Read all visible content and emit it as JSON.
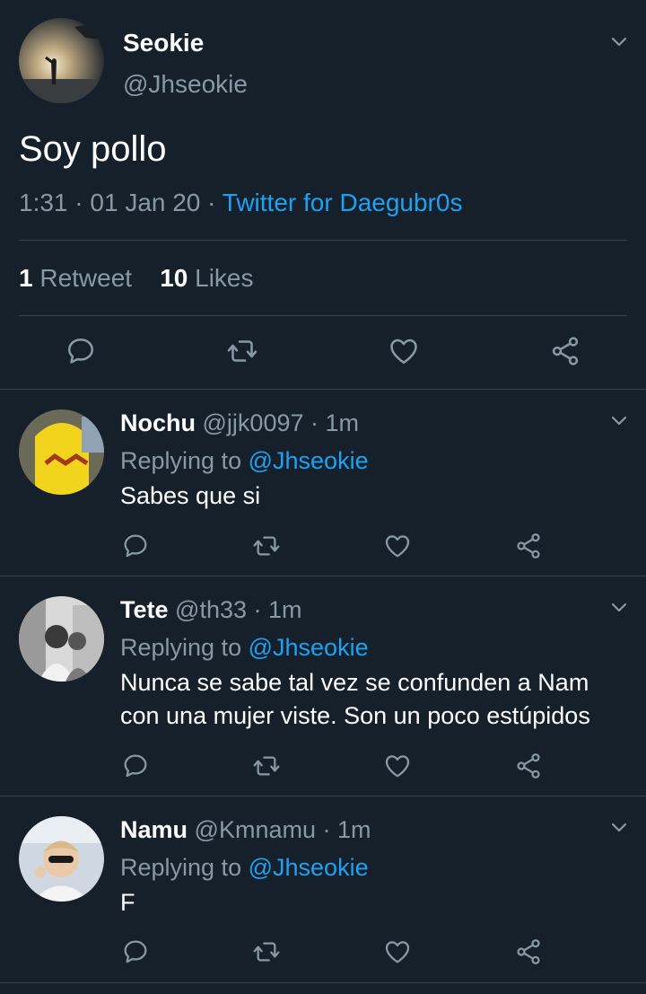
{
  "main_tweet": {
    "name": "Seokie",
    "handle": "@Jhseokie",
    "text": "Soy pollo",
    "time": "1:31",
    "sep1": "·",
    "date": "01 Jan 20",
    "sep2": "·",
    "source": "Twitter for Daegubr0s",
    "retweet_count": "1",
    "retweet_label": "Retweet",
    "like_count": "10",
    "like_label": "Likes"
  },
  "replies": [
    {
      "name": "Nochu",
      "handle": "@jjk0097",
      "time": "· 1m",
      "replying_label": "Replying to",
      "replying_to": "@Jhseokie",
      "text": "Sabes que si"
    },
    {
      "name": "Tete",
      "handle": "@th33",
      "time": "· 1m",
      "replying_label": "Replying to",
      "replying_to": "@Jhseokie",
      "text_line1": "Nunca se sabe tal vez se confunden a Nam",
      "text_line2": "con una mujer viste. Son un poco estúpidos"
    },
    {
      "name": "Namu",
      "handle": "@Kmnamu",
      "time": "· 1m",
      "replying_label": "Replying to",
      "replying_to": "@Jhseokie",
      "text": "F"
    }
  ],
  "icons": [
    "chevron-down-icon",
    "reply-icon",
    "retweet-icon",
    "like-icon",
    "share-icon"
  ],
  "colors": {
    "background": "#15202b",
    "accent": "#1da1f2",
    "secondary_text": "#8899a6",
    "divider": "#38444d"
  }
}
